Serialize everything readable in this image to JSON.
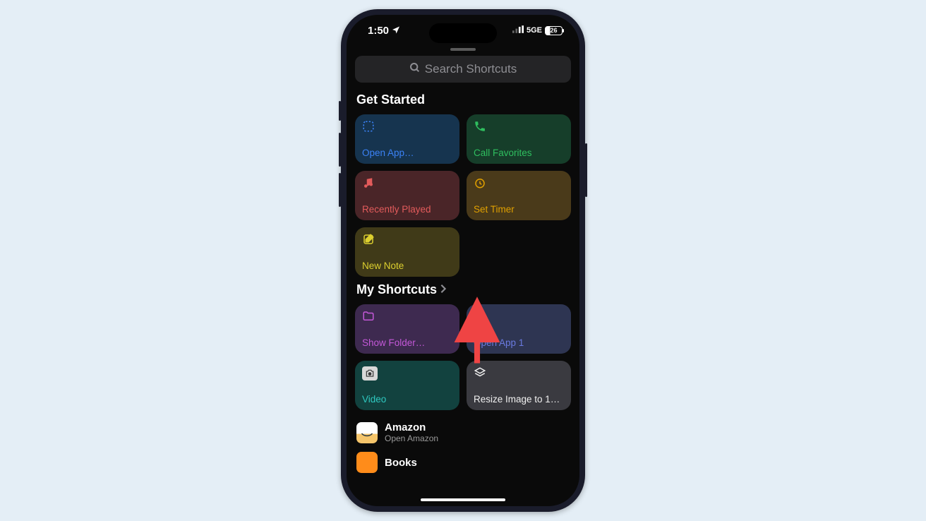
{
  "status": {
    "time": "1:50",
    "network": "5GE",
    "battery": "26"
  },
  "search": {
    "placeholder": "Search Shortcuts"
  },
  "sections": {
    "get_started": "Get Started",
    "my_shortcuts": "My Shortcuts"
  },
  "tiles": {
    "open_app": {
      "label": "Open App…",
      "icon": "dashed-square-icon"
    },
    "call_favorites": {
      "label": "Call Favorites",
      "icon": "phone-icon"
    },
    "recently_played": {
      "label": "Recently Played",
      "icon": "music-note-icon"
    },
    "set_timer": {
      "label": "Set Timer",
      "icon": "timer-icon"
    },
    "new_note": {
      "label": "New Note",
      "icon": "compose-icon"
    },
    "show_folder": {
      "label": "Show Folder…",
      "icon": "folder-icon"
    },
    "open_app_1": {
      "label": "Open App 1",
      "icon": "stack-icon"
    },
    "video": {
      "label": "Video",
      "icon": "camera-icon"
    },
    "resize": {
      "label": "Resize Image to 1…",
      "icon": "stack-icon"
    }
  },
  "list": {
    "amazon": {
      "title": "Amazon",
      "subtitle": "Open Amazon"
    },
    "books": {
      "title": "Books"
    }
  },
  "annotation": {
    "arrow_target": "show_folder"
  }
}
